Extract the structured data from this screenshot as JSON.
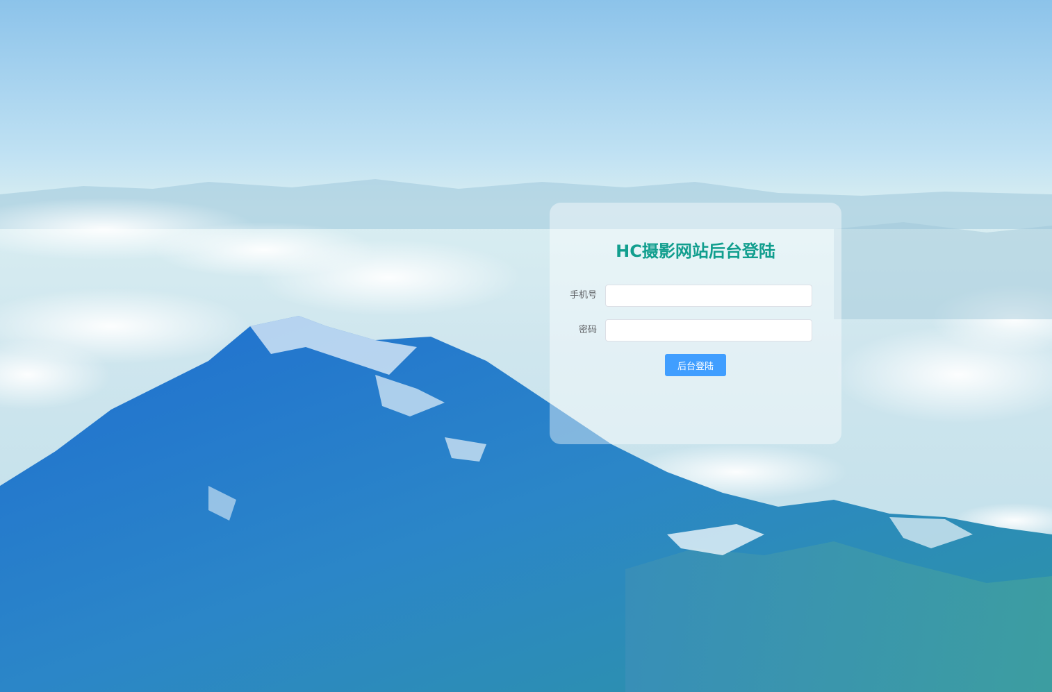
{
  "login": {
    "title": "HC摄影网站后台登陆",
    "phone_label": "手机号",
    "phone_value": "",
    "password_label": "密码",
    "password_value": "",
    "submit_label": "后台登陆"
  },
  "colors": {
    "title": "#119e8e",
    "button": "#409eff",
    "label": "#606266"
  }
}
